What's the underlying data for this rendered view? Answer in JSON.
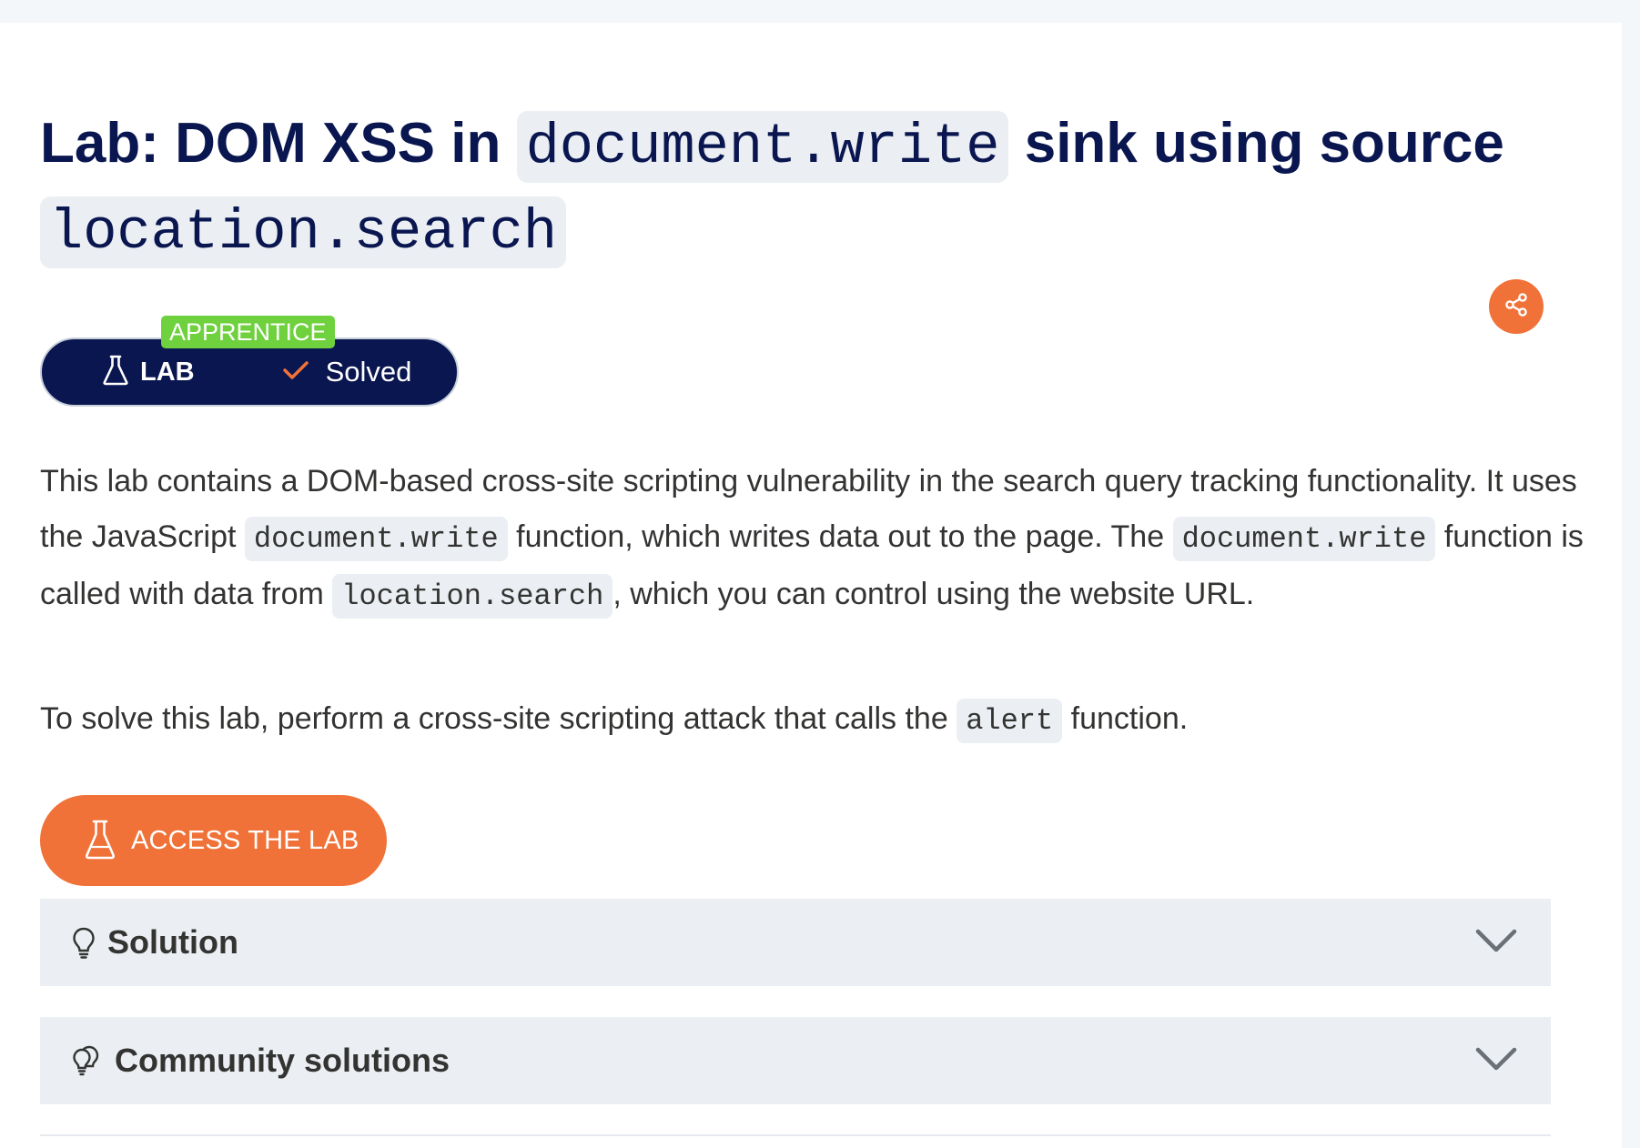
{
  "title": {
    "prefix": "Lab: DOM XSS in ",
    "code1": "document.write",
    "middle": " sink using source ",
    "code2": "location.search"
  },
  "badge": {
    "level": "APPRENTICE",
    "type_label": "LAB",
    "status_label": "Solved"
  },
  "description": {
    "p1_a": "This lab contains a DOM-based cross-site scripting vulnerability in the search query tracking functionality. It uses the JavaScript ",
    "p1_code1": "document.write",
    "p1_b": " function, which writes data out to the page. The ",
    "p1_code2": "document.write",
    "p1_c": " function is called with data from ",
    "p1_code3": "location.search",
    "p1_d": ", which you can control using the website URL.",
    "p2_a": "To solve this lab, perform a cross-site scripting attack that calls the ",
    "p2_code": "alert",
    "p2_b": " function."
  },
  "access_button": {
    "label": "ACCESS THE LAB"
  },
  "accordions": [
    {
      "label": "Solution",
      "icon": "lightbulb-icon"
    },
    {
      "label": "Community solutions",
      "icon": "lightbulbs-icon"
    }
  ],
  "colors": {
    "navy": "#0a1650",
    "orange": "#f07238",
    "green": "#6fd13e",
    "panel": "#ebeef2"
  }
}
